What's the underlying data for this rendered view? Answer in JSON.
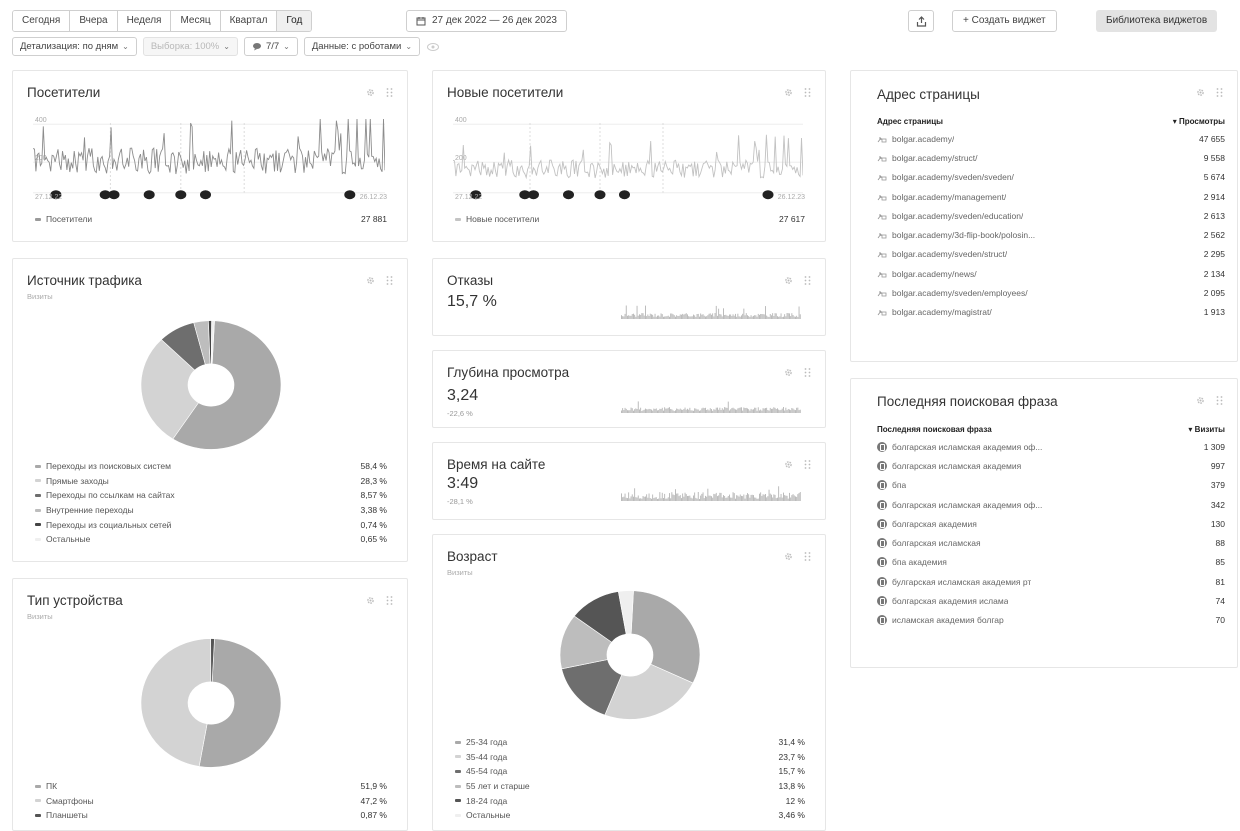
{
  "toolbar": {
    "periods": [
      "Сегодня",
      "Вчера",
      "Неделя",
      "Месяц",
      "Квартал",
      "Год"
    ],
    "active_period": "Год",
    "date_range": "27 дек 2022 — 26 дек 2023",
    "create_widget": "+ Создать виджет",
    "widget_library": "Библиотека виджетов"
  },
  "filters": {
    "detail": "Детализация: по дням",
    "sample": "Выборка: 100%",
    "attribution": "7/7",
    "robots": "Данные: с роботами"
  },
  "visitors": {
    "title": "Посетители",
    "y_ticks": [
      "400",
      "200"
    ],
    "x_start": "27.12.22",
    "x_end": "26.12.23",
    "legend_label": "Посетители",
    "legend_value": "27 881"
  },
  "new_visitors": {
    "title": "Новые посетители",
    "y_ticks": [
      "400",
      "200"
    ],
    "x_start": "27.12.22",
    "x_end": "26.12.23",
    "legend_label": "Новые посетители",
    "legend_value": "27 617"
  },
  "traffic": {
    "title": "Источник трафика",
    "subtitle": "Визиты",
    "items": [
      {
        "label": "Переходы из поисковых систем",
        "value": "58,4 %",
        "pct": 58.4,
        "color": "#a9a9a9"
      },
      {
        "label": "Прямые заходы",
        "value": "28,3 %",
        "pct": 28.3,
        "color": "#d3d3d3"
      },
      {
        "label": "Переходы по ссылкам на сайтах",
        "value": "8,57 %",
        "pct": 8.57,
        "color": "#6e6e6e"
      },
      {
        "label": "Внутренние переходы",
        "value": "3,38 %",
        "pct": 3.38,
        "color": "#bdbdbd"
      },
      {
        "label": "Переходы из социальных сетей",
        "value": "0,74 %",
        "pct": 0.74,
        "color": "#444444"
      },
      {
        "label": "Остальные",
        "value": "0,65 %",
        "pct": 0.65,
        "color": "#efefef"
      }
    ]
  },
  "device": {
    "title": "Тип устройства",
    "subtitle": "Визиты",
    "items": [
      {
        "label": "ПК",
        "value": "51,9 %",
        "pct": 51.9,
        "color": "#a9a9a9"
      },
      {
        "label": "Смартфоны",
        "value": "47,2 %",
        "pct": 47.2,
        "color": "#d3d3d3"
      },
      {
        "label": "Планшеты",
        "value": "0,87 %",
        "pct": 0.87,
        "color": "#555555"
      }
    ]
  },
  "bounce": {
    "title": "Отказы",
    "value": "15,7 %"
  },
  "depth": {
    "title": "Глубина просмотра",
    "value": "3,24",
    "delta": "-22,6 %"
  },
  "time": {
    "title": "Время на сайте",
    "value": "3:49",
    "delta": "-28,1 %"
  },
  "age": {
    "title": "Возраст",
    "subtitle": "Визиты",
    "items": [
      {
        "label": "25-34 года",
        "value": "31,4 %",
        "pct": 31.4,
        "color": "#a9a9a9"
      },
      {
        "label": "35-44 года",
        "value": "23,7 %",
        "pct": 23.7,
        "color": "#d3d3d3"
      },
      {
        "label": "45-54 года",
        "value": "15,7 %",
        "pct": 15.7,
        "color": "#6e6e6e"
      },
      {
        "label": "55 лет и старше",
        "value": "13,8 %",
        "pct": 13.8,
        "color": "#bdbdbd"
      },
      {
        "label": "18-24 года",
        "value": "12 %",
        "pct": 12,
        "color": "#555555"
      },
      {
        "label": "Остальные",
        "value": "3,46 %",
        "pct": 3.46,
        "color": "#efefef"
      }
    ]
  },
  "pages": {
    "title": "Адрес страницы",
    "col_left": "Адрес страницы",
    "col_right": "▾ Просмотры",
    "rows": [
      {
        "url": "bolgar.academy/",
        "value": "47 655"
      },
      {
        "url": "bolgar.academy/struct/",
        "value": "9 558"
      },
      {
        "url": "bolgar.academy/sveden/sveden/",
        "value": "5 674"
      },
      {
        "url": "bolgar.academy/management/",
        "value": "2 914"
      },
      {
        "url": "bolgar.academy/sveden/education/",
        "value": "2 613"
      },
      {
        "url": "bolgar.academy/3d-flip-book/polosin...",
        "value": "2 562"
      },
      {
        "url": "bolgar.academy/sveden/struct/",
        "value": "2 295"
      },
      {
        "url": "bolgar.academy/news/",
        "value": "2 134"
      },
      {
        "url": "bolgar.academy/sveden/employees/",
        "value": "2 095"
      },
      {
        "url": "bolgar.academy/magistrat/",
        "value": "1 913"
      }
    ]
  },
  "search": {
    "title": "Последняя поисковая фраза",
    "col_left": "Последняя поисковая фраза",
    "col_right": "▾ Визиты",
    "rows": [
      {
        "phrase": "болгарская исламская академия оф...",
        "value": "1 309"
      },
      {
        "phrase": "болгарская исламская академия",
        "value": "997"
      },
      {
        "phrase": "бпа",
        "value": "379"
      },
      {
        "phrase": "болгарская исламская академия оф...",
        "value": "342"
      },
      {
        "phrase": "болгарская академия",
        "value": "130"
      },
      {
        "phrase": "болгарская исламская",
        "value": "88"
      },
      {
        "phrase": "бпа академия",
        "value": "85"
      },
      {
        "phrase": "булгарская исламская академия рт",
        "value": "81"
      },
      {
        "phrase": "болгарская академия ислама",
        "value": "74"
      },
      {
        "phrase": "исламская академия болгар",
        "value": "70"
      }
    ]
  }
}
